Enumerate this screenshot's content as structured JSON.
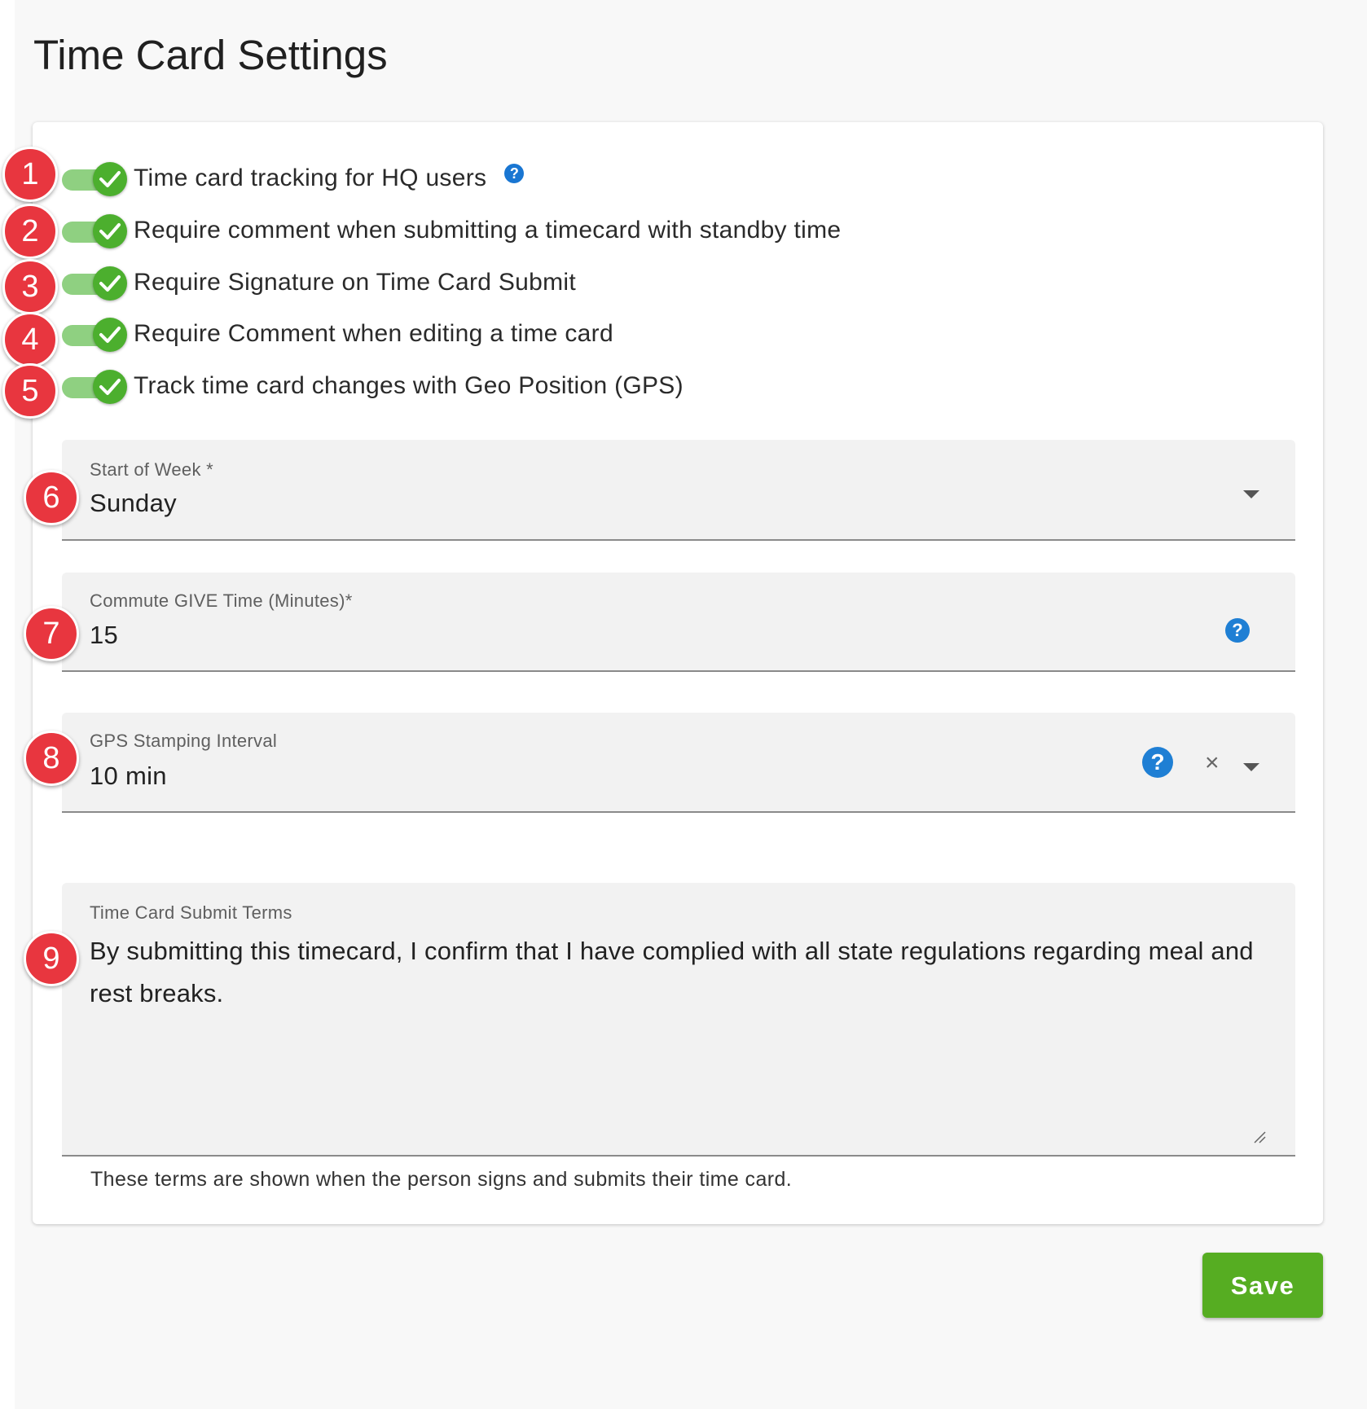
{
  "page": {
    "title": "Time Card Settings"
  },
  "toggles": [
    {
      "number": "1",
      "label": "Time card tracking for HQ users",
      "checked": true,
      "has_help": true
    },
    {
      "number": "2",
      "label": "Require comment when submitting a timecard with standby time",
      "checked": true
    },
    {
      "number": "3",
      "label": "Require Signature on Time Card Submit",
      "checked": true
    },
    {
      "number": "4",
      "label": "Require Comment when editing a time card",
      "checked": true
    },
    {
      "number": "5",
      "label": "Track time card changes with Geo Position (GPS)",
      "checked": true
    }
  ],
  "fields": {
    "start_of_week": {
      "number": "6",
      "label": "Start of Week *",
      "value": "Sunday"
    },
    "commute_time": {
      "number": "7",
      "label": "Commute GIVE Time (Minutes)*",
      "value": "15"
    },
    "gps_interval": {
      "number": "8",
      "label": "GPS Stamping Interval",
      "value": "10 min"
    },
    "submit_terms": {
      "number": "9",
      "label": "Time Card Submit Terms",
      "value": "By submitting this timecard, I confirm that I have complied with all state regulations regarding meal and rest breaks.",
      "hint": "These terms are shown when the person signs and submits their time card."
    }
  },
  "icons": {
    "help": "question-mark-circle-icon",
    "clear": "close-icon",
    "dropdown": "caret-down-icon",
    "check": "check-icon"
  },
  "colors": {
    "toggle_on": "#4caf2e",
    "toggle_track": "#8fd081",
    "help_blue": "#1f7fd4",
    "marker_red": "#e8363f",
    "save_green": "#56ad22"
  },
  "save_label": "Save",
  "glyphs": {
    "question": "?",
    "close": "×"
  }
}
